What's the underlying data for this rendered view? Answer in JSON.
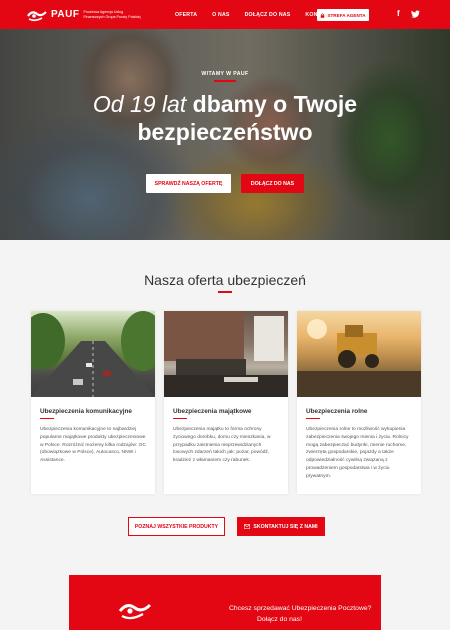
{
  "header": {
    "logo_name": "PAUF",
    "logo_sub": "Pocztowa Agencja Usług Finansowych Grupa Poczty Polskiej",
    "nav": [
      "OFERTA",
      "O NAS",
      "DOŁĄCZ DO NAS",
      "KONTAKT"
    ],
    "agent_button": "STREFA AGENTA",
    "facebook": "f",
    "twitter": "twitter-icon"
  },
  "hero": {
    "label": "WITAMY W PAUF",
    "title_italic": "Od 19 lat",
    "title_bold_1": "dbamy o Twoje",
    "title_bold_2": "bezpieczeństwo",
    "btn_offer": "SPRAWDŹ NASZĄ OFERTĘ",
    "btn_join": "DOŁĄCZ DO NAS"
  },
  "offer": {
    "title": "Nasza oferta ubezpieczeń",
    "cards": [
      {
        "title": "Ubezpieczenia komunikacyjne",
        "text": "Ubezpieczenia komunikacyjne to najbardziej popularne majątkowe produkty ubezpieczeniowe w Polsce. Rozróżnić możemy kilka rodzajów: OC (obowiązkowe w Polsce), Autocasco, NNW i Assistance."
      },
      {
        "title": "Ubezpieczenia majątkowe",
        "text": "Ubezpieczenia majątku to forma ochrony życiowego dorobku, domu czy mieszkania, w przypadku zaistnienia nieprzewidzianych losowych zdarzeń takich jak: pożar, powódź, kradzież z włamaniem czy rabunek."
      },
      {
        "title": "Ubezpieczenia rolne",
        "text": "Ubezpieczenia rolne to możliwość wykupienia zabezpieczenia swojego mienia i życia. Rolnicy mogą zabezpieczać budynki, mienie ruchome, zwierzęta gospodarskie, pojazdy a także odpowiedzialność cywilną związaną z prowadzeniem gospodarstwa i w życiu prywatnym."
      }
    ],
    "btn_all": "POZNAJ WSZYSTKIE PRODUKTY",
    "btn_contact": "SKONTAKTUJ SIĘ Z NAMI"
  },
  "bottom": {
    "line1": "Chcesz sprzedawać Ubezpieczenia Pocztowe?",
    "line2": "Dołącz do nas!"
  },
  "colors": {
    "brand_red": "#e30613"
  }
}
